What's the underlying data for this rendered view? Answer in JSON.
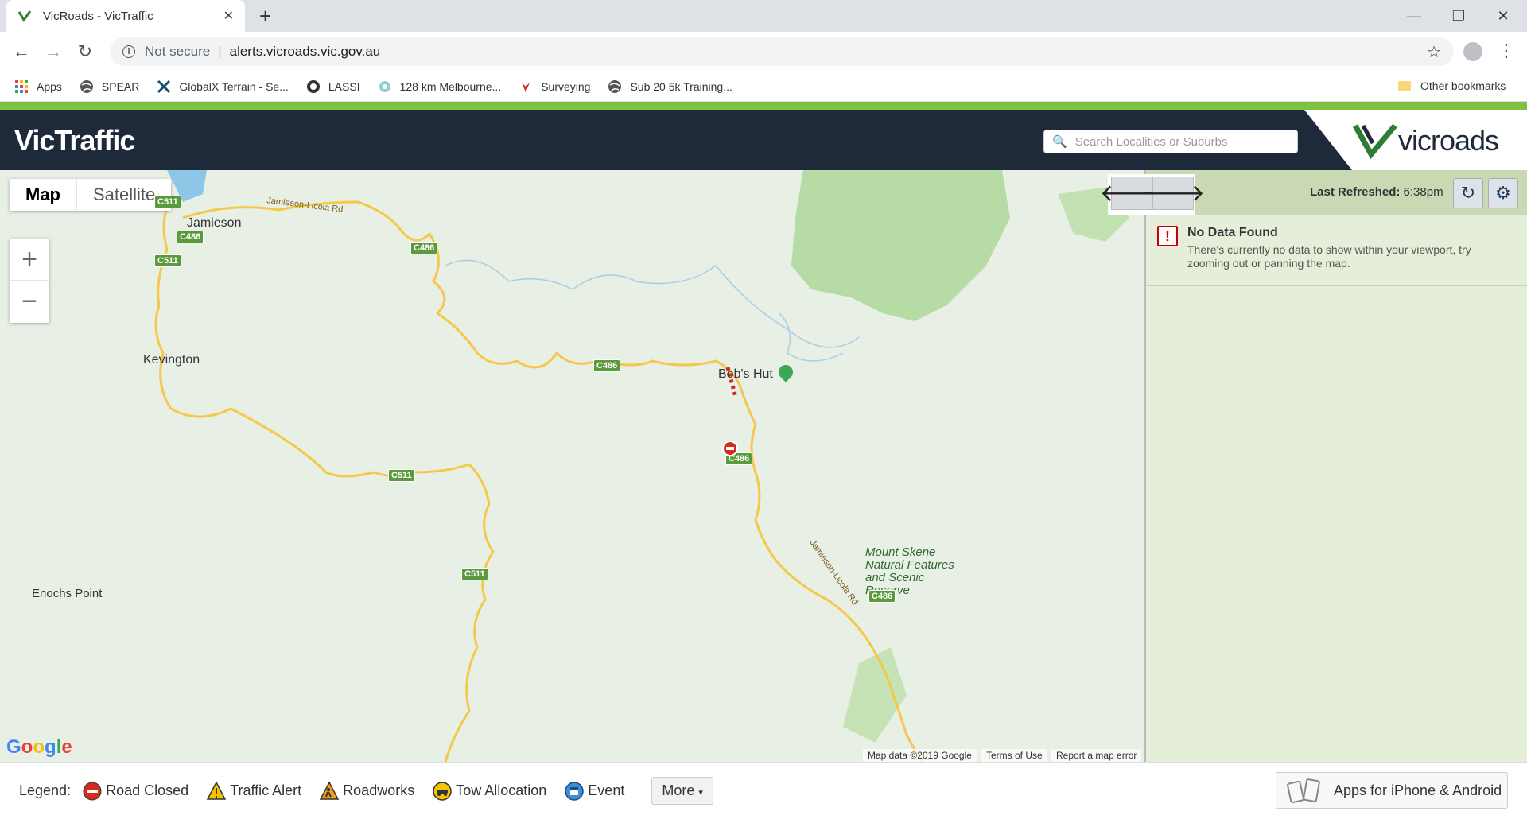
{
  "browser": {
    "tab_title": "VicRoads - VicTraffic",
    "omnibox_security": "Not secure",
    "omnibox_url": "alerts.vicroads.vic.gov.au",
    "bookmarks": [
      "Apps",
      "SPEAR",
      "GlobalX Terrain - Se...",
      "LASSI",
      "128 km Melbourne...",
      "Surveying",
      "Sub 20 5k Training..."
    ],
    "other_bookmarks": "Other bookmarks"
  },
  "header": {
    "brand": "VicTraffic",
    "search_placeholder": "Search Localities or Suburbs",
    "logo_text": "vicroads"
  },
  "map": {
    "types": [
      "Map",
      "Satellite"
    ],
    "places": {
      "jamieson": "Jamieson",
      "kevington": "Kevington",
      "bobs_hut": "Bob's Hut",
      "enochs_point": "Enochs Point",
      "mount_skene": "Mount Skene Natural Features and Scenic Reserve"
    },
    "roads": {
      "jamieson_licola_rd": "Jamieson-Licola Rd",
      "c511": "C511",
      "c486": "C486"
    },
    "google": "Google",
    "attribution": [
      "Map data ©2019 Google",
      "Terms of Use",
      "Report a map error"
    ]
  },
  "panel": {
    "last_refreshed_label": "Last Refreshed:",
    "last_refreshed_time": "6:38pm",
    "no_data_title": "No Data Found",
    "no_data_message": "There's currently no data to show within your viewport, try zooming out or panning the map."
  },
  "legend": {
    "label": "Legend:",
    "items": [
      "Road Closed",
      "Traffic Alert",
      "Roadworks",
      "Tow Allocation",
      "Event"
    ],
    "more": "More",
    "apps": "Apps for iPhone & Android"
  },
  "colors": {
    "header_bg": "#1e2a3a",
    "accent_green": "#7dc242",
    "road_yellow": "#f5c84c",
    "closed_red": "#d52b1e"
  }
}
